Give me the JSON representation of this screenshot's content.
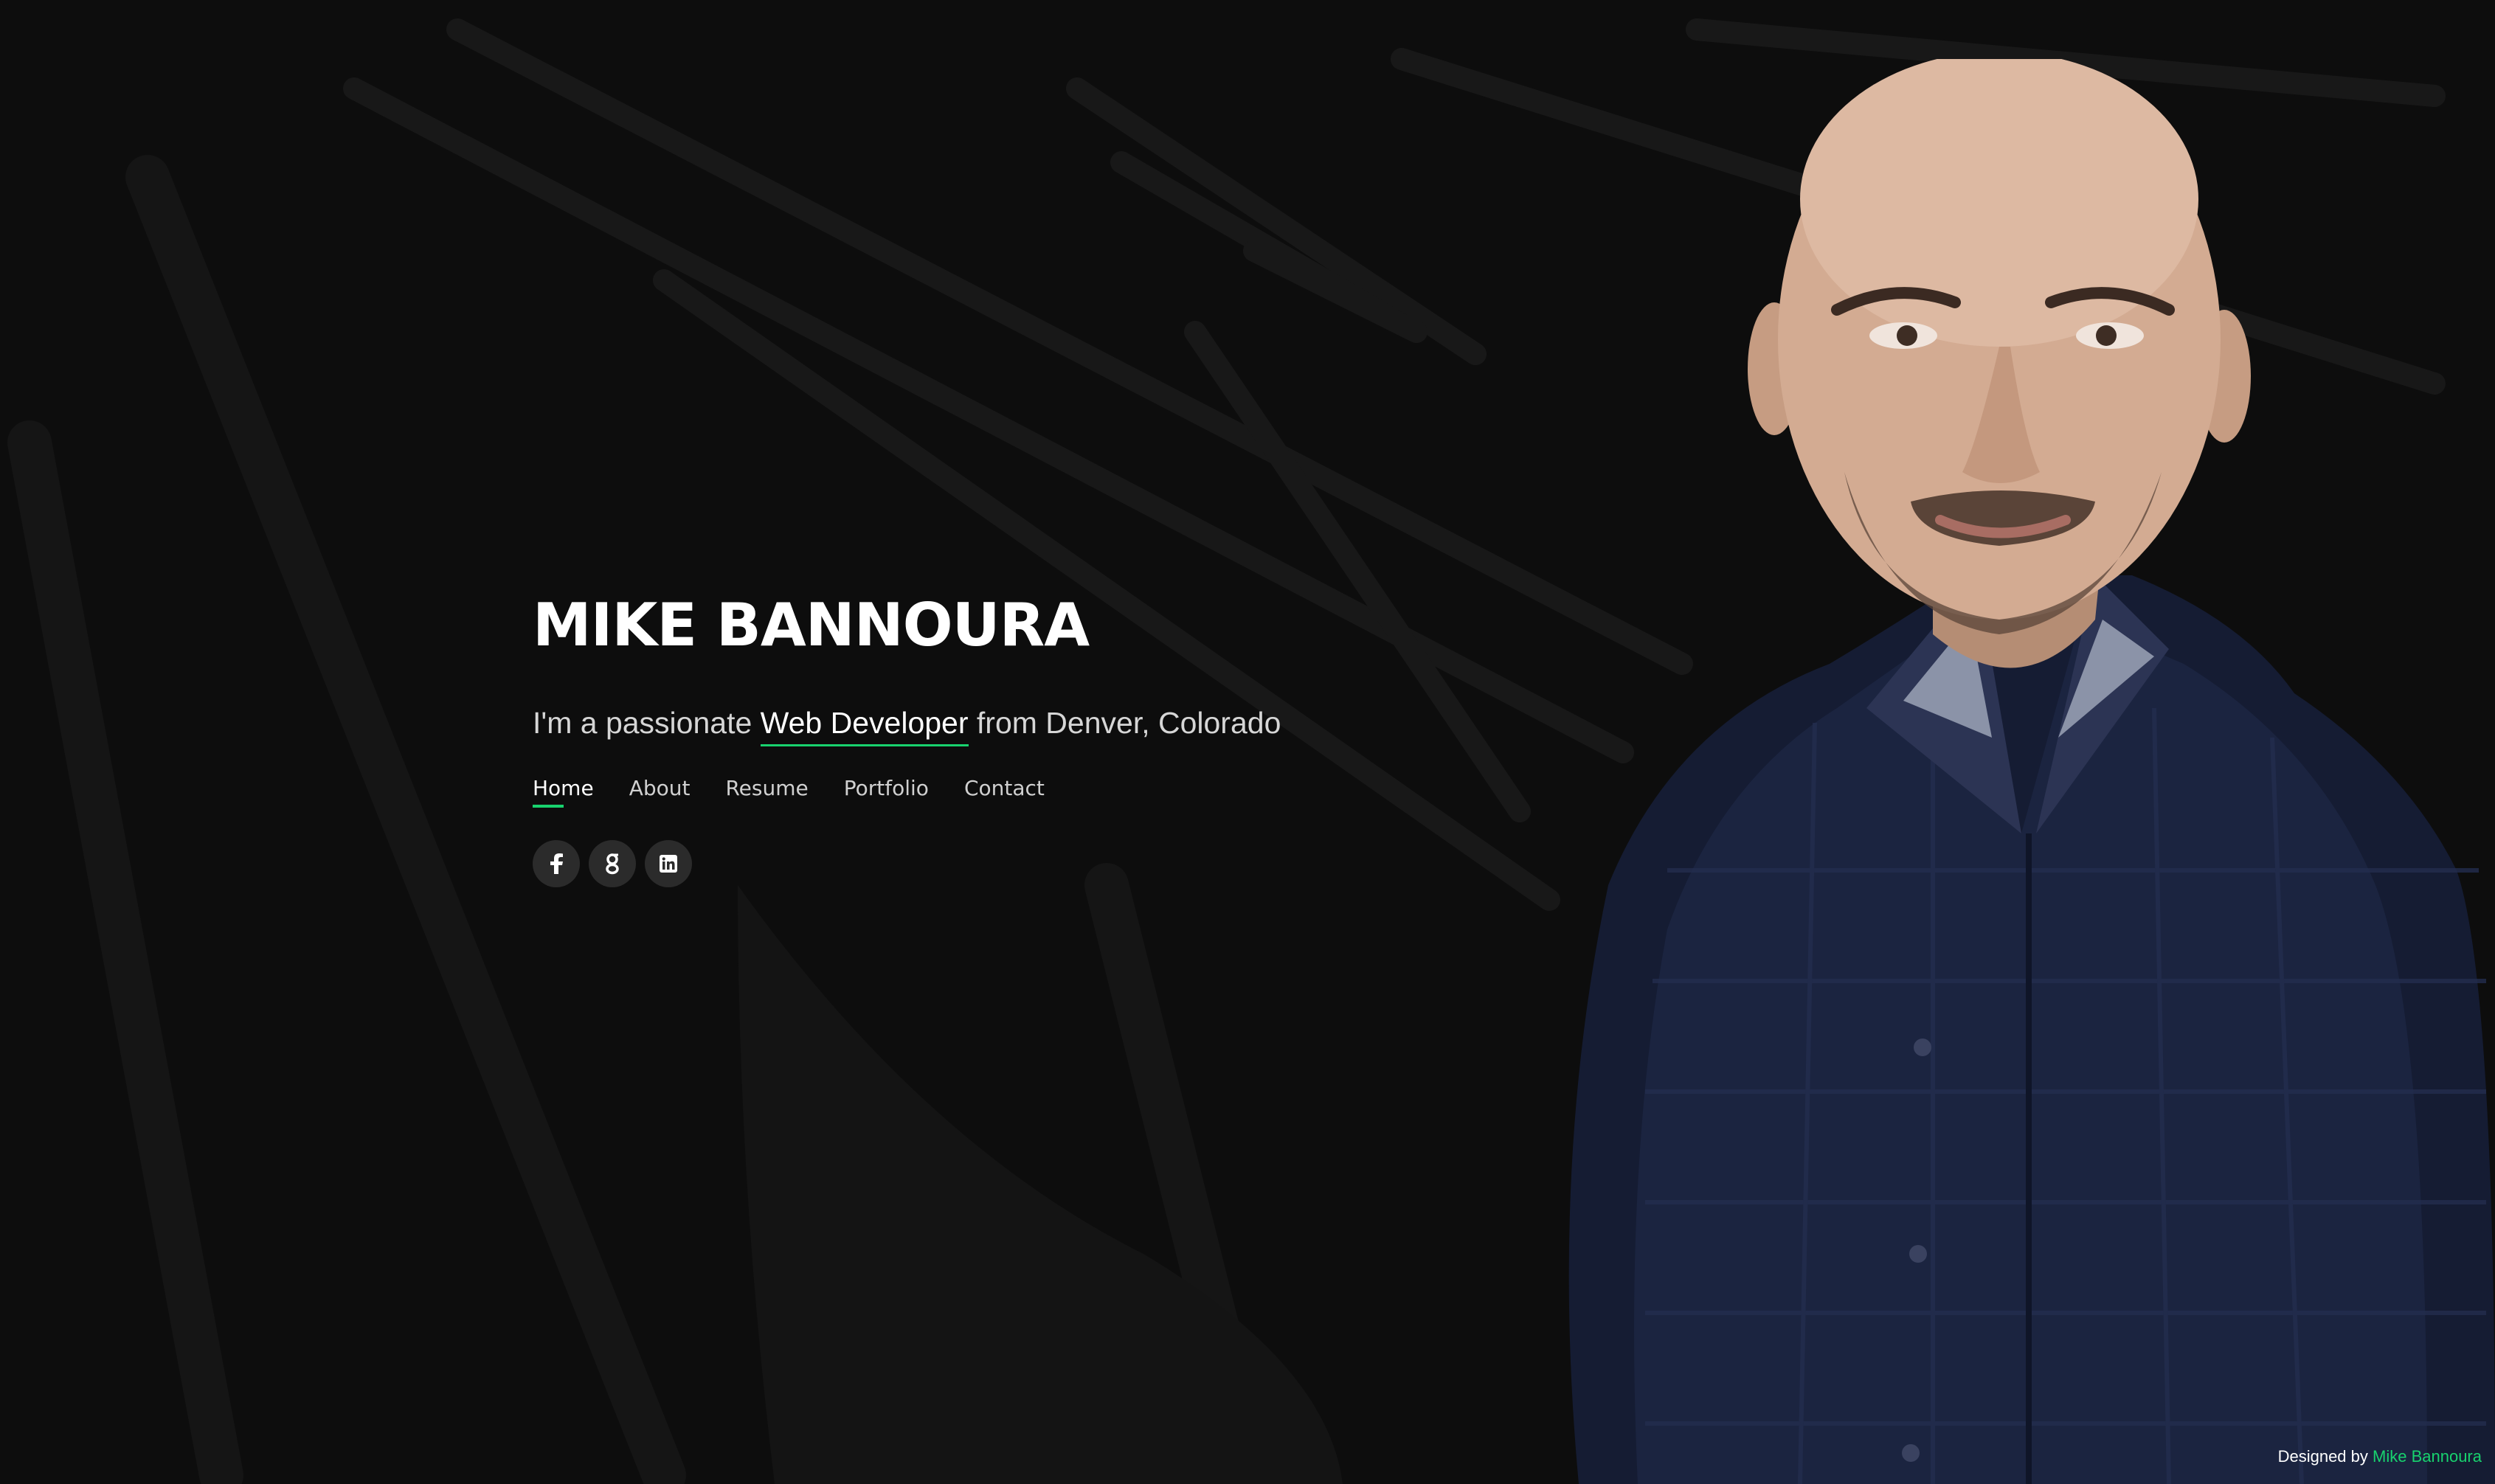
{
  "hero": {
    "name": "MIKE BANNOURA",
    "tagline_prefix": "I'm a passionate ",
    "tagline_role": "Web Developer",
    "tagline_suffix": " from Denver, Colorado"
  },
  "nav": {
    "items": [
      {
        "label": "Home",
        "active": true
      },
      {
        "label": "About",
        "active": false
      },
      {
        "label": "Resume",
        "active": false
      },
      {
        "label": "Portfolio",
        "active": false
      },
      {
        "label": "Contact",
        "active": false
      }
    ]
  },
  "social": {
    "icons": [
      "facebook-icon",
      "google-plus-icon",
      "linkedin-icon"
    ]
  },
  "footer": {
    "prefix": "Designed by ",
    "author": "Mike Bannoura"
  },
  "colors": {
    "accent": "#18d26e",
    "background": "#0d0d0d",
    "social_button": "#2b2b2b"
  }
}
